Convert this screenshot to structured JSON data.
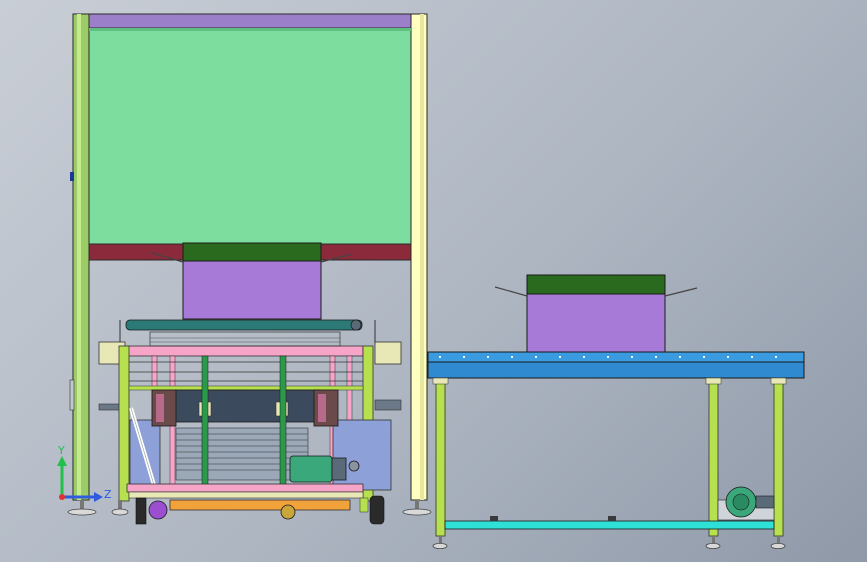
{
  "viewport": {
    "background_top": "#c9ced6",
    "background_bottom": "#8f99a8"
  },
  "colors": {
    "hopper": "#7ddd9e",
    "hopper_top": "#9b7fc9",
    "hopper_base": "#8b2a3a",
    "box_purple": "#a67ad6",
    "box_lid": "#2a6a1e",
    "frame_yellow": "#ffffc0",
    "frame_green": "#b6e04e",
    "frame_pink": "#f6a4c8",
    "conveyor_blue": "#3a9be0",
    "conveyor_cyan": "#2fe0d6",
    "motor_green": "#3aa87a",
    "press_dark": "#3c4a5e",
    "roller_teal": "#2c7a78",
    "orange_base": "#f2a23a",
    "leg_gray": "#d9d9d9"
  },
  "triad": {
    "icon": "axis-triad-icon",
    "y_label": "Y",
    "z_label": "Z",
    "y_color": "#22c04a",
    "z_color": "#2f5be0",
    "x_color": "#e03030"
  }
}
